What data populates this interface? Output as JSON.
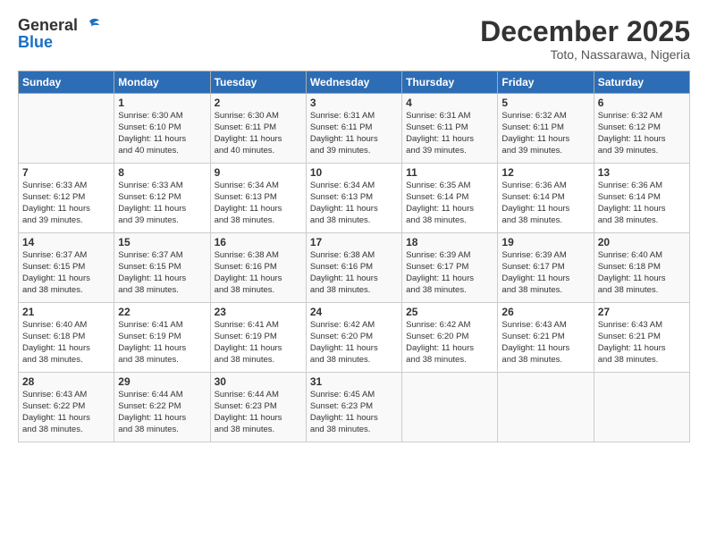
{
  "header": {
    "logo_general": "General",
    "logo_blue": "Blue",
    "month_title": "December 2025",
    "location": "Toto, Nassarawa, Nigeria"
  },
  "days_of_week": [
    "Sunday",
    "Monday",
    "Tuesday",
    "Wednesday",
    "Thursday",
    "Friday",
    "Saturday"
  ],
  "weeks": [
    [
      {
        "day": "",
        "info": ""
      },
      {
        "day": "1",
        "info": "Sunrise: 6:30 AM\nSunset: 6:10 PM\nDaylight: 11 hours\nand 40 minutes."
      },
      {
        "day": "2",
        "info": "Sunrise: 6:30 AM\nSunset: 6:11 PM\nDaylight: 11 hours\nand 40 minutes."
      },
      {
        "day": "3",
        "info": "Sunrise: 6:31 AM\nSunset: 6:11 PM\nDaylight: 11 hours\nand 39 minutes."
      },
      {
        "day": "4",
        "info": "Sunrise: 6:31 AM\nSunset: 6:11 PM\nDaylight: 11 hours\nand 39 minutes."
      },
      {
        "day": "5",
        "info": "Sunrise: 6:32 AM\nSunset: 6:11 PM\nDaylight: 11 hours\nand 39 minutes."
      },
      {
        "day": "6",
        "info": "Sunrise: 6:32 AM\nSunset: 6:12 PM\nDaylight: 11 hours\nand 39 minutes."
      }
    ],
    [
      {
        "day": "7",
        "info": "Sunrise: 6:33 AM\nSunset: 6:12 PM\nDaylight: 11 hours\nand 39 minutes."
      },
      {
        "day": "8",
        "info": "Sunrise: 6:33 AM\nSunset: 6:12 PM\nDaylight: 11 hours\nand 39 minutes."
      },
      {
        "day": "9",
        "info": "Sunrise: 6:34 AM\nSunset: 6:13 PM\nDaylight: 11 hours\nand 38 minutes."
      },
      {
        "day": "10",
        "info": "Sunrise: 6:34 AM\nSunset: 6:13 PM\nDaylight: 11 hours\nand 38 minutes."
      },
      {
        "day": "11",
        "info": "Sunrise: 6:35 AM\nSunset: 6:14 PM\nDaylight: 11 hours\nand 38 minutes."
      },
      {
        "day": "12",
        "info": "Sunrise: 6:36 AM\nSunset: 6:14 PM\nDaylight: 11 hours\nand 38 minutes."
      },
      {
        "day": "13",
        "info": "Sunrise: 6:36 AM\nSunset: 6:14 PM\nDaylight: 11 hours\nand 38 minutes."
      }
    ],
    [
      {
        "day": "14",
        "info": "Sunrise: 6:37 AM\nSunset: 6:15 PM\nDaylight: 11 hours\nand 38 minutes."
      },
      {
        "day": "15",
        "info": "Sunrise: 6:37 AM\nSunset: 6:15 PM\nDaylight: 11 hours\nand 38 minutes."
      },
      {
        "day": "16",
        "info": "Sunrise: 6:38 AM\nSunset: 6:16 PM\nDaylight: 11 hours\nand 38 minutes."
      },
      {
        "day": "17",
        "info": "Sunrise: 6:38 AM\nSunset: 6:16 PM\nDaylight: 11 hours\nand 38 minutes."
      },
      {
        "day": "18",
        "info": "Sunrise: 6:39 AM\nSunset: 6:17 PM\nDaylight: 11 hours\nand 38 minutes."
      },
      {
        "day": "19",
        "info": "Sunrise: 6:39 AM\nSunset: 6:17 PM\nDaylight: 11 hours\nand 38 minutes."
      },
      {
        "day": "20",
        "info": "Sunrise: 6:40 AM\nSunset: 6:18 PM\nDaylight: 11 hours\nand 38 minutes."
      }
    ],
    [
      {
        "day": "21",
        "info": "Sunrise: 6:40 AM\nSunset: 6:18 PM\nDaylight: 11 hours\nand 38 minutes."
      },
      {
        "day": "22",
        "info": "Sunrise: 6:41 AM\nSunset: 6:19 PM\nDaylight: 11 hours\nand 38 minutes."
      },
      {
        "day": "23",
        "info": "Sunrise: 6:41 AM\nSunset: 6:19 PM\nDaylight: 11 hours\nand 38 minutes."
      },
      {
        "day": "24",
        "info": "Sunrise: 6:42 AM\nSunset: 6:20 PM\nDaylight: 11 hours\nand 38 minutes."
      },
      {
        "day": "25",
        "info": "Sunrise: 6:42 AM\nSunset: 6:20 PM\nDaylight: 11 hours\nand 38 minutes."
      },
      {
        "day": "26",
        "info": "Sunrise: 6:43 AM\nSunset: 6:21 PM\nDaylight: 11 hours\nand 38 minutes."
      },
      {
        "day": "27",
        "info": "Sunrise: 6:43 AM\nSunset: 6:21 PM\nDaylight: 11 hours\nand 38 minutes."
      }
    ],
    [
      {
        "day": "28",
        "info": "Sunrise: 6:43 AM\nSunset: 6:22 PM\nDaylight: 11 hours\nand 38 minutes."
      },
      {
        "day": "29",
        "info": "Sunrise: 6:44 AM\nSunset: 6:22 PM\nDaylight: 11 hours\nand 38 minutes."
      },
      {
        "day": "30",
        "info": "Sunrise: 6:44 AM\nSunset: 6:23 PM\nDaylight: 11 hours\nand 38 minutes."
      },
      {
        "day": "31",
        "info": "Sunrise: 6:45 AM\nSunset: 6:23 PM\nDaylight: 11 hours\nand 38 minutes."
      },
      {
        "day": "",
        "info": ""
      },
      {
        "day": "",
        "info": ""
      },
      {
        "day": "",
        "info": ""
      }
    ]
  ]
}
